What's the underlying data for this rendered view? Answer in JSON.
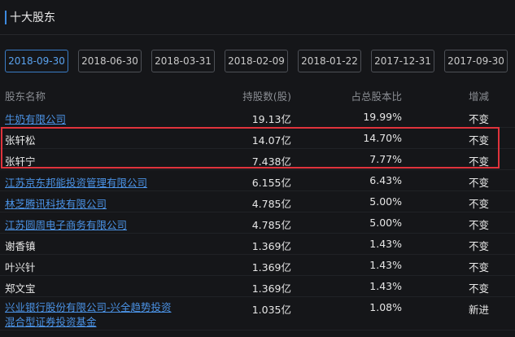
{
  "section": {
    "title": "十大股东"
  },
  "tabs": [
    {
      "label": "2018-09-30",
      "active": true
    },
    {
      "label": "2018-06-30",
      "active": false
    },
    {
      "label": "2018-03-31",
      "active": false
    },
    {
      "label": "2018-02-09",
      "active": false
    },
    {
      "label": "2018-01-22",
      "active": false
    },
    {
      "label": "2017-12-31",
      "active": false
    },
    {
      "label": "2017-09-30",
      "active": false
    }
  ],
  "table": {
    "headers": {
      "name": "股东名称",
      "shares": "持股数(股)",
      "pct": "占总股本比",
      "change": "增减"
    },
    "rows": [
      {
        "name": "牛奶有限公司",
        "shares": "19.13亿",
        "pct": "19.99%",
        "change": "不变",
        "link": true
      },
      {
        "name": "张轩松",
        "shares": "14.07亿",
        "pct": "14.70%",
        "change": "不变",
        "link": false
      },
      {
        "name": "张轩宁",
        "shares": "7.438亿",
        "pct": "7.77%",
        "change": "不变",
        "link": false
      },
      {
        "name": "江苏京东邦能投资管理有限公司",
        "shares": "6.155亿",
        "pct": "6.43%",
        "change": "不变",
        "link": true
      },
      {
        "name": "林芝腾讯科技有限公司",
        "shares": "4.785亿",
        "pct": "5.00%",
        "change": "不变",
        "link": true
      },
      {
        "name": "江苏圆周电子商务有限公司",
        "shares": "4.785亿",
        "pct": "5.00%",
        "change": "不变",
        "link": true
      },
      {
        "name": "谢香镇",
        "shares": "1.369亿",
        "pct": "1.43%",
        "change": "不变",
        "link": false
      },
      {
        "name": "叶兴针",
        "shares": "1.369亿",
        "pct": "1.43%",
        "change": "不变",
        "link": false
      },
      {
        "name": "郑文宝",
        "shares": "1.369亿",
        "pct": "1.43%",
        "change": "不变",
        "link": false
      },
      {
        "name": "兴业银行股份有限公司-兴全趋势投资混合型证券投资基金",
        "shares": "1.035亿",
        "pct": "1.08%",
        "change": "新进",
        "link": true
      }
    ]
  },
  "colors": {
    "accent": "#3d8ae0",
    "link": "#4b93e6",
    "highlight": "#e0333c",
    "background": "#151619"
  }
}
